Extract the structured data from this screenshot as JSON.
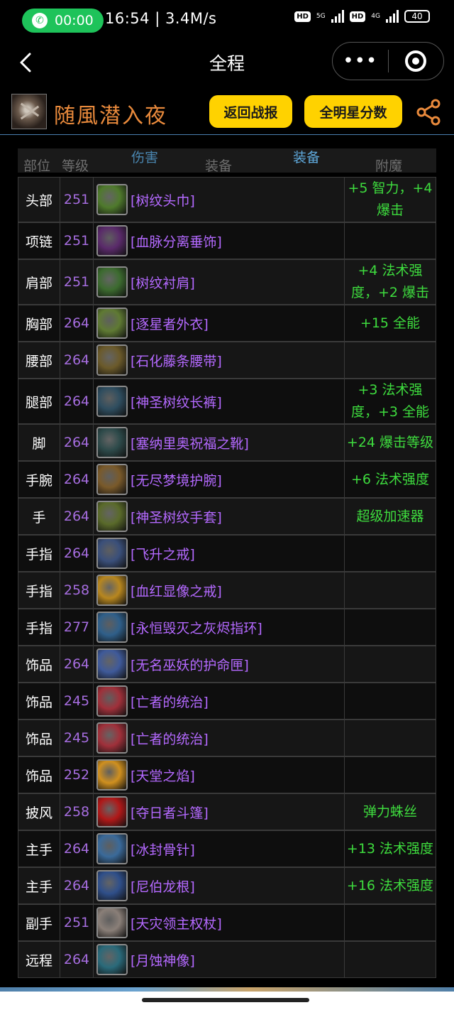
{
  "status_bar": {
    "call_timer": "00:00",
    "time_speed": "16:54 | 3.4M/s",
    "hd1": "HD",
    "net1": "5G",
    "hd2": "HD",
    "net2": "4G",
    "battery": "40"
  },
  "nav": {
    "title": "全程",
    "more_glyph": "•••"
  },
  "header": {
    "character_name": "随風潜入夜",
    "back_report_label": "返回战报",
    "all_star_label": "全明星分数"
  },
  "table": {
    "headers": {
      "slot": "部位",
      "level": "等级",
      "damage": "伤害",
      "gear": "装备",
      "gear_tab": "装备",
      "enchant": "附魔"
    },
    "rows": [
      {
        "slot": "头部",
        "level": "251",
        "item": "[树纹头巾]",
        "enchant": "+5 智力，+4 爆击",
        "icon_color": "#4f7a2c",
        "tall": true
      },
      {
        "slot": "项链",
        "level": "251",
        "item": "[血脉分离垂饰]",
        "enchant": "",
        "icon_color": "#5a2a6a",
        "tall": false
      },
      {
        "slot": "肩部",
        "level": "251",
        "item": "[树纹衬肩]",
        "enchant": "+4 法术强度，+2 爆击",
        "icon_color": "#3c6b2f",
        "tall": true
      },
      {
        "slot": "胸部",
        "level": "264",
        "item": "[逐星者外衣]",
        "enchant": "+15 全能",
        "icon_color": "#5f7a33",
        "tall": false
      },
      {
        "slot": "腰部",
        "level": "264",
        "item": "[石化藤条腰带]",
        "enchant": "",
        "icon_color": "#6b5a2a",
        "tall": false
      },
      {
        "slot": "腿部",
        "level": "264",
        "item": "[神圣树纹长裤]",
        "enchant": "+3 法术强度，+3 全能",
        "icon_color": "#2e4d5f",
        "tall": true
      },
      {
        "slot": "脚",
        "level": "264",
        "item": "[塞纳里奥祝福之靴]",
        "enchant": "+24 爆击等级",
        "icon_color": "#2d4a4a",
        "tall": false
      },
      {
        "slot": "手腕",
        "level": "264",
        "item": "[无尽梦境护腕]",
        "enchant": "+6 法术强度",
        "icon_color": "#7a5a2a",
        "tall": false
      },
      {
        "slot": "手",
        "level": "264",
        "item": "[神圣树纹手套]",
        "enchant": "超级加速器",
        "icon_color": "#5a6a2a",
        "tall": false
      },
      {
        "slot": "手指",
        "level": "264",
        "item": "[飞升之戒]",
        "enchant": "",
        "icon_color": "#3a4f7a",
        "tall": false
      },
      {
        "slot": "手指",
        "level": "258",
        "item": "[血红显像之戒]",
        "enchant": "",
        "icon_color": "#b8871f",
        "tall": false
      },
      {
        "slot": "手指",
        "level": "277",
        "item": "[永恒毁灭之灰烬指环]",
        "enchant": "",
        "icon_color": "#2f5f8a",
        "tall": false
      },
      {
        "slot": "饰品",
        "level": "264",
        "item": "[无名巫妖的护命匣]",
        "enchant": "",
        "icon_color": "#3f5a9a",
        "tall": false
      },
      {
        "slot": "饰品",
        "level": "245",
        "item": "[亡者的统治]",
        "enchant": "",
        "icon_color": "#a0303a",
        "tall": false
      },
      {
        "slot": "饰品",
        "level": "245",
        "item": "[亡者的统治]",
        "enchant": "",
        "icon_color": "#a0303a",
        "tall": false
      },
      {
        "slot": "饰品",
        "level": "252",
        "item": "[天堂之焰]",
        "enchant": "",
        "icon_color": "#d0901f",
        "tall": false
      },
      {
        "slot": "披风",
        "level": "258",
        "item": "[夺日者斗篷]",
        "enchant": "弹力蛛丝",
        "icon_color": "#b01818",
        "tall": false
      },
      {
        "slot": "主手",
        "level": "264",
        "item": "[冰封骨针]",
        "enchant": "+13 法术强度",
        "icon_color": "#3a6a9a",
        "tall": false
      },
      {
        "slot": "主手",
        "level": "264",
        "item": "[尼伯龙根]",
        "enchant": "+16 法术强度",
        "icon_color": "#2f4f8a",
        "tall": false
      },
      {
        "slot": "副手",
        "level": "251",
        "item": "[天灾领主权杖]",
        "enchant": "",
        "icon_color": "#8a7f78",
        "tall": false
      },
      {
        "slot": "远程",
        "level": "264",
        "item": "[月蚀神像]",
        "enchant": "",
        "icon_color": "#2a6a7a",
        "tall": false
      }
    ]
  },
  "colors": {
    "accent_yellow": "#ffd200",
    "name_orange": "#e98a3c",
    "item_purple": "#b469ff",
    "level_purple": "#a66de0",
    "enchant_green": "#3edc3e",
    "header_blue": "#5fa9dc"
  }
}
